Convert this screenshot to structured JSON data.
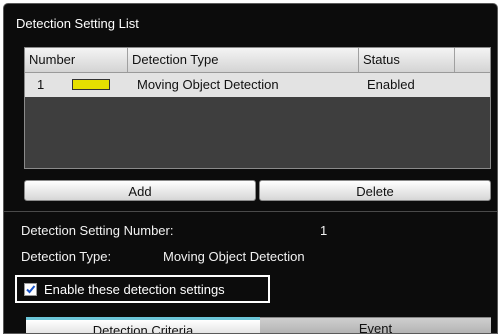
{
  "panel": {
    "title": "Detection Setting List"
  },
  "table": {
    "columns": [
      "Number",
      "Detection Type",
      "Status"
    ],
    "rows": [
      {
        "number": "1",
        "color": "#e6e000",
        "type": "Moving Object Detection",
        "status": "Enabled"
      }
    ]
  },
  "buttons": {
    "add": "Add",
    "delete": "Delete"
  },
  "details": {
    "number_label": "Detection Setting Number:",
    "number_value": "1",
    "type_label": "Detection Type:",
    "type_value": "Moving Object Detection"
  },
  "enable": {
    "label": "Enable these detection settings",
    "checked": true
  },
  "tabs": [
    "Detection Criteria",
    "Event"
  ],
  "colors": {
    "accent_tab": "#6cc6d8",
    "panel_bg": "#0c0c0c",
    "row_swatch": "#e6e000"
  }
}
